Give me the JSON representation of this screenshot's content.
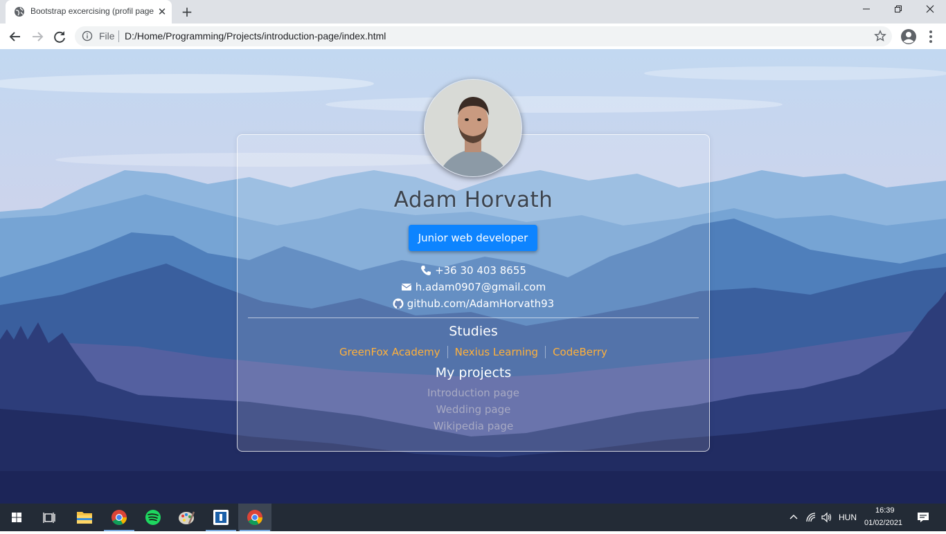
{
  "browser": {
    "tab_title": "Bootstrap excercising (profil page)",
    "new_tab_label": "+",
    "url_scheme_label": "File",
    "url": "D:/Home/Programming/Projects/introduction-page/index.html"
  },
  "profile": {
    "name": "Adam Horvath",
    "role": "Junior web developer",
    "phone": "+36 30 403 8655",
    "email": "h.adam0907@gmail.com",
    "github": "github.com/AdamHorvath93"
  },
  "studies": {
    "heading": "Studies",
    "items": [
      "GreenFox Academy",
      "Nexius Learning",
      "CodeBerry"
    ]
  },
  "projects": {
    "heading": "My projects",
    "items": [
      "Introduction page",
      "Wedding page",
      "Wikipedia page"
    ]
  },
  "taskbar": {
    "language": "HUN",
    "time": "16:39",
    "date": "01/02/2021"
  },
  "colors": {
    "accent_button": "#0d84ff",
    "study_link": "#ffb13b",
    "project_link": "#a8aac3",
    "taskbar": "#232b36"
  },
  "icons": [
    "globe-icon",
    "close-icon",
    "back-arrow-icon",
    "forward-arrow-icon",
    "reload-icon",
    "info-icon",
    "star-icon",
    "account-icon",
    "menu-icon",
    "phone-icon",
    "envelope-icon",
    "github-icon",
    "windows-start-icon",
    "task-view-icon",
    "file-explorer-icon",
    "chrome-icon",
    "spotify-icon",
    "paint-icon",
    "notification-icon"
  ]
}
